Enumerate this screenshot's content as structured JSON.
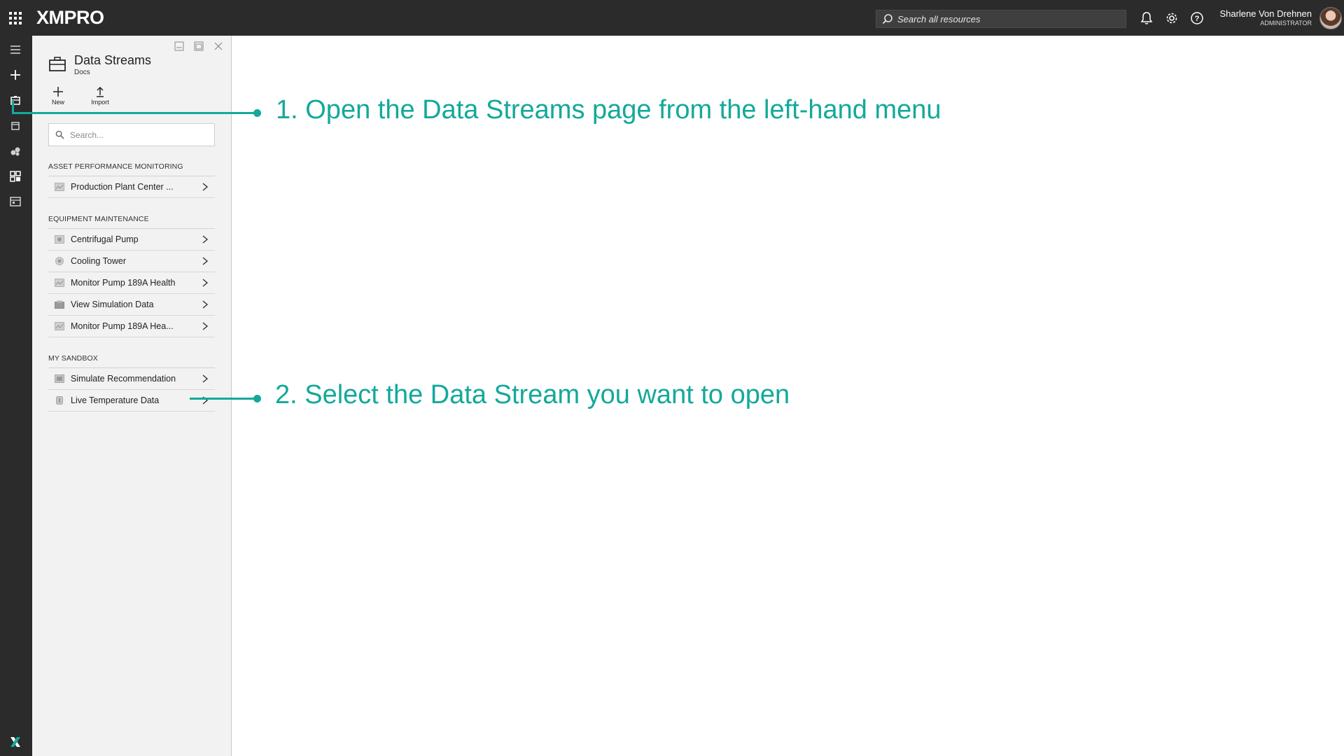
{
  "app": {
    "logo": "XMPRO",
    "search_placeholder": "Search all resources",
    "user": {
      "name": "Sharlene Von Drehnen",
      "role": "ADMINISTRATOR"
    }
  },
  "panel": {
    "title": "Data Streams",
    "subtitle": "Docs",
    "toolbar": {
      "new_label": "New",
      "import_label": "Import"
    },
    "search_placeholder": "Search...",
    "groups": [
      {
        "title": "ASSET PERFORMANCE MONITORING",
        "items": [
          {
            "label": "Production Plant Center ..."
          }
        ]
      },
      {
        "title": "EQUIPMENT MAINTENANCE",
        "items": [
          {
            "label": "Centrifugal Pump"
          },
          {
            "label": "Cooling Tower"
          },
          {
            "label": "Monitor Pump 189A Health"
          },
          {
            "label": "View Simulation Data"
          },
          {
            "label": "Monitor Pump 189A Hea..."
          }
        ]
      },
      {
        "title": "MY SANDBOX",
        "items": [
          {
            "label": "Simulate Recommendation"
          },
          {
            "label": "Live Temperature Data"
          }
        ]
      }
    ]
  },
  "annotations": {
    "step1": "1. Open the Data Streams page from the left-hand menu",
    "step2": "2. Select the Data Stream you want to open"
  },
  "colors": {
    "topbar": "#2b2b2b",
    "panel": "#f2f2f2",
    "annotation": "#13a99a"
  }
}
